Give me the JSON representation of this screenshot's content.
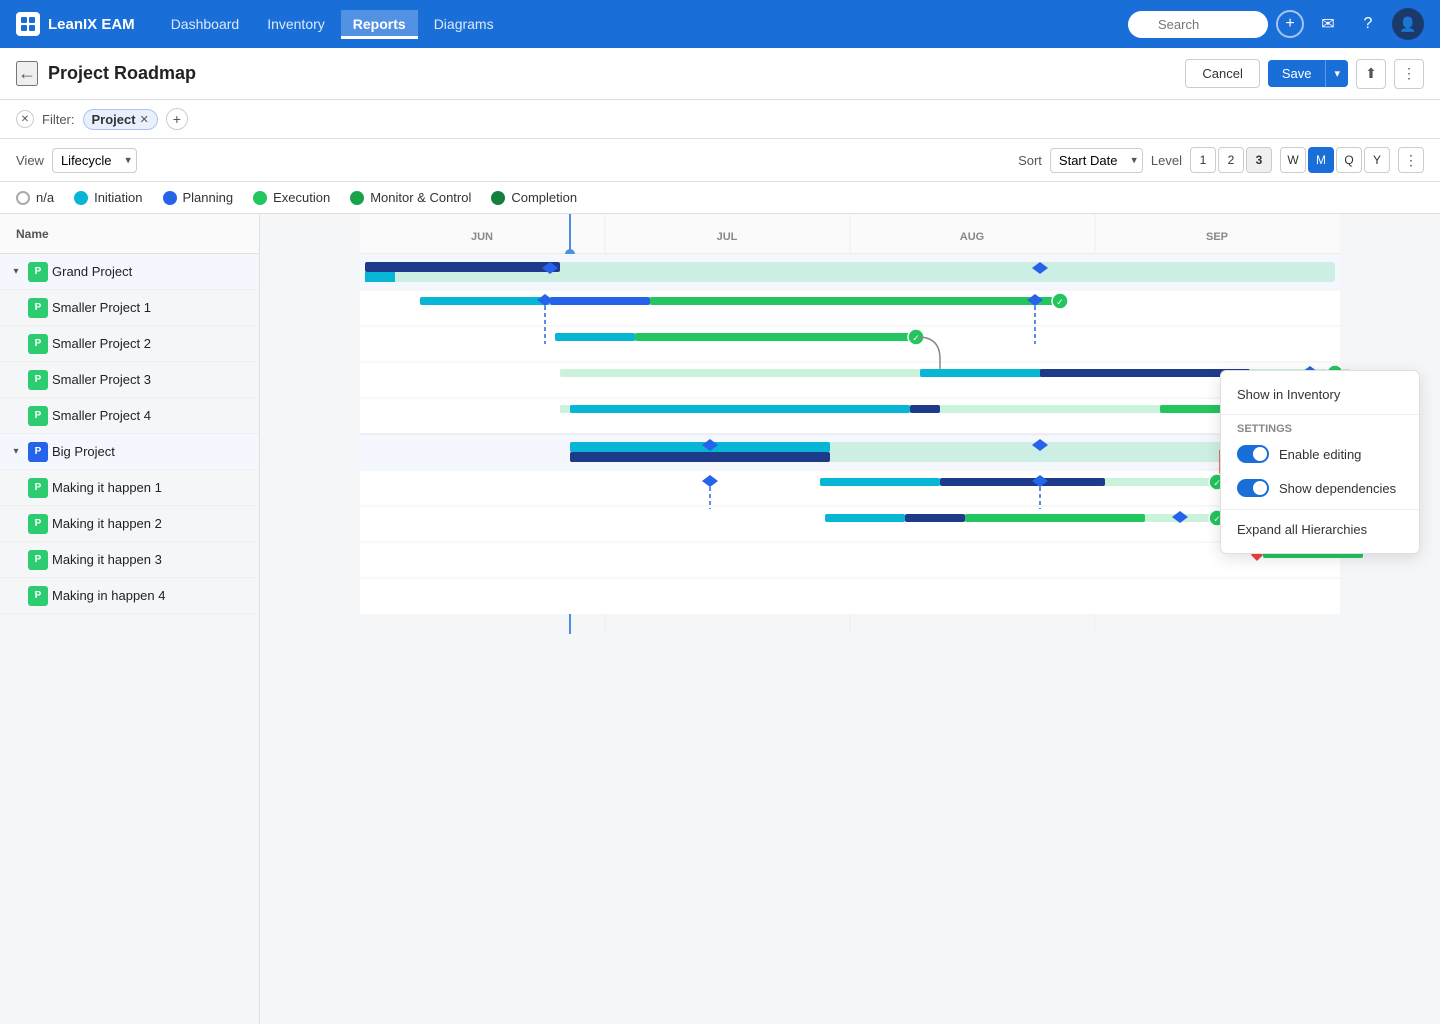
{
  "app": {
    "name": "LeanIX EAM",
    "logo_text": "✦"
  },
  "nav": {
    "links": [
      {
        "label": "Dashboard",
        "active": false
      },
      {
        "label": "Inventory",
        "active": false
      },
      {
        "label": "Reports",
        "active": true
      },
      {
        "label": "Diagrams",
        "active": false
      }
    ],
    "search_placeholder": "Search",
    "search_label": "Search"
  },
  "page": {
    "title": "Project Roadmap",
    "cancel_label": "Cancel",
    "save_label": "Save"
  },
  "filter": {
    "label": "Filter:",
    "chip_label": "Project",
    "add_label": "+"
  },
  "toolbar": {
    "view_label": "View",
    "view_value": "Lifecycle",
    "sort_label": "Sort",
    "sort_value": "Start Date",
    "level_label": "Level",
    "levels": [
      "1",
      "2",
      "3"
    ],
    "time_units": [
      "W",
      "M",
      "Q",
      "Y"
    ],
    "active_time_unit": "M"
  },
  "legend": {
    "items": [
      {
        "label": "n/a",
        "color": "empty",
        "hex": ""
      },
      {
        "label": "Initiation",
        "color": "#06b6d4",
        "hex": "#06b6d4"
      },
      {
        "label": "Planning",
        "color": "#2563eb",
        "hex": "#2563eb"
      },
      {
        "label": "Execution",
        "color": "#22c55e",
        "hex": "#22c55e"
      },
      {
        "label": "Monitor & Control",
        "color": "#16a34a",
        "hex": "#16a34a"
      },
      {
        "label": "Completion",
        "color": "#15803d",
        "hex": "#15803d"
      }
    ]
  },
  "gantt": {
    "columns": [
      "JUN",
      "JUL",
      "AUG",
      "SEP"
    ],
    "name_header": "Name",
    "rows": [
      {
        "id": "grand-project",
        "name": "Grand Project",
        "level": 0,
        "expandable": true,
        "badge": "P",
        "badge_color": "green"
      },
      {
        "id": "smaller-project-1",
        "name": "Smaller Project 1",
        "level": 1,
        "badge": "P",
        "badge_color": "green"
      },
      {
        "id": "smaller-project-2",
        "name": "Smaller Project 2",
        "level": 1,
        "badge": "P",
        "badge_color": "green"
      },
      {
        "id": "smaller-project-3",
        "name": "Smaller Project 3",
        "level": 1,
        "badge": "P",
        "badge_color": "green"
      },
      {
        "id": "smaller-project-4",
        "name": "Smaller Project 4",
        "level": 1,
        "badge": "P",
        "badge_color": "green"
      },
      {
        "id": "big-project",
        "name": "Big Project",
        "level": 0,
        "expandable": true,
        "badge": "P",
        "badge_color": "blue"
      },
      {
        "id": "making-it-happen-1",
        "name": "Making it happen 1",
        "level": 1,
        "badge": "P",
        "badge_color": "green"
      },
      {
        "id": "making-it-happen-2",
        "name": "Making it happen 2",
        "level": 1,
        "badge": "P",
        "badge_color": "green"
      },
      {
        "id": "making-it-happen-3",
        "name": "Making it happen 3",
        "level": 1,
        "badge": "P",
        "badge_color": "green"
      },
      {
        "id": "making-in-happen-4",
        "name": "Making in happen 4",
        "level": 1,
        "badge": "P",
        "badge_color": "green"
      }
    ]
  },
  "context_menu": {
    "show_in_inventory": "Show in Inventory",
    "settings_label": "Settings",
    "enable_editing_label": "Enable editing",
    "show_dependencies_label": "Show dependencies",
    "expand_all_label": "Expand all Hierarchies"
  }
}
